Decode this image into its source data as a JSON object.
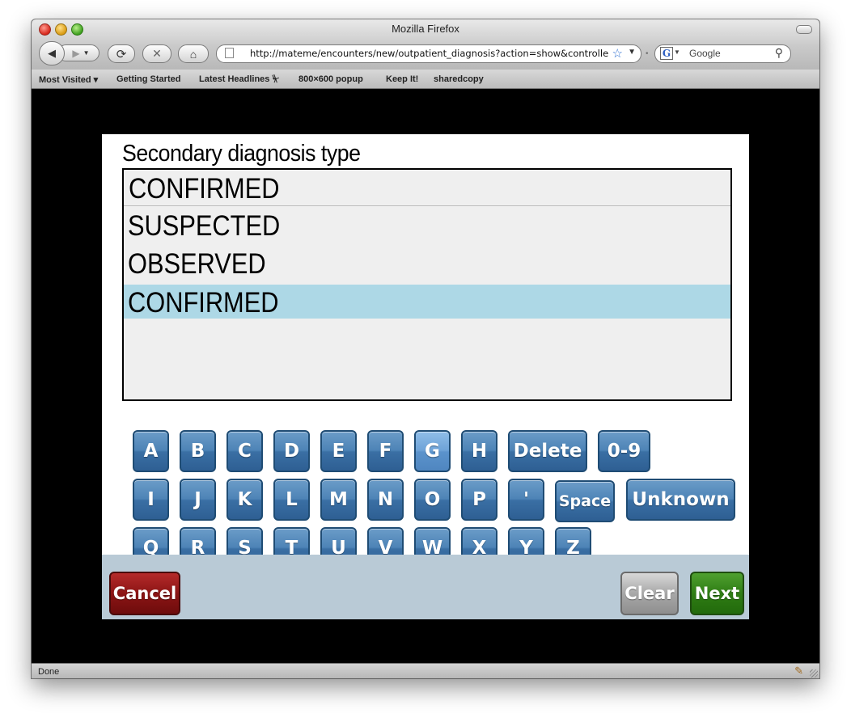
{
  "window": {
    "title": "Mozilla Firefox"
  },
  "toolbar": {
    "url": "http://mateme/encounters/new/outpatient_diagnosis?action=show&controller=encounters",
    "search_placeholder": "Google",
    "search_engine_icon": "G"
  },
  "bookmarks": {
    "items": [
      "Most Visited ▾",
      "Getting Started",
      "Latest Headlines ⏧",
      "800×600 popup",
      "Keep It!",
      "sharedcopy"
    ]
  },
  "status": {
    "text": "Done"
  },
  "form": {
    "question": "Secondary diagnosis type",
    "input_value": "CONFIRMED",
    "options": [
      {
        "label": "SUSPECTED",
        "selected": false
      },
      {
        "label": "OBSERVED",
        "selected": false
      },
      {
        "label": "CONFIRMED",
        "selected": true
      }
    ]
  },
  "keyboard": {
    "row1": [
      "A",
      "B",
      "C",
      "D",
      "E",
      "F",
      "G",
      "H",
      "Delete",
      "0-9"
    ],
    "row2": [
      "I",
      "J",
      "K",
      "L",
      "M",
      "N",
      "O",
      "P",
      "'",
      "Space",
      "Unknown"
    ],
    "row3": [
      "Q",
      "R",
      "S",
      "T",
      "U",
      "V",
      "W",
      "X",
      "Y",
      "Z"
    ]
  },
  "buttons": {
    "cancel": "Cancel",
    "clear": "Clear",
    "next": "Next"
  },
  "colors": {
    "selected_row": "#add8e6",
    "key_blue": "#3a6fa4",
    "cancel_red": "#8c1515",
    "next_green": "#2f7d14",
    "footer_bg": "#b9cad6"
  }
}
